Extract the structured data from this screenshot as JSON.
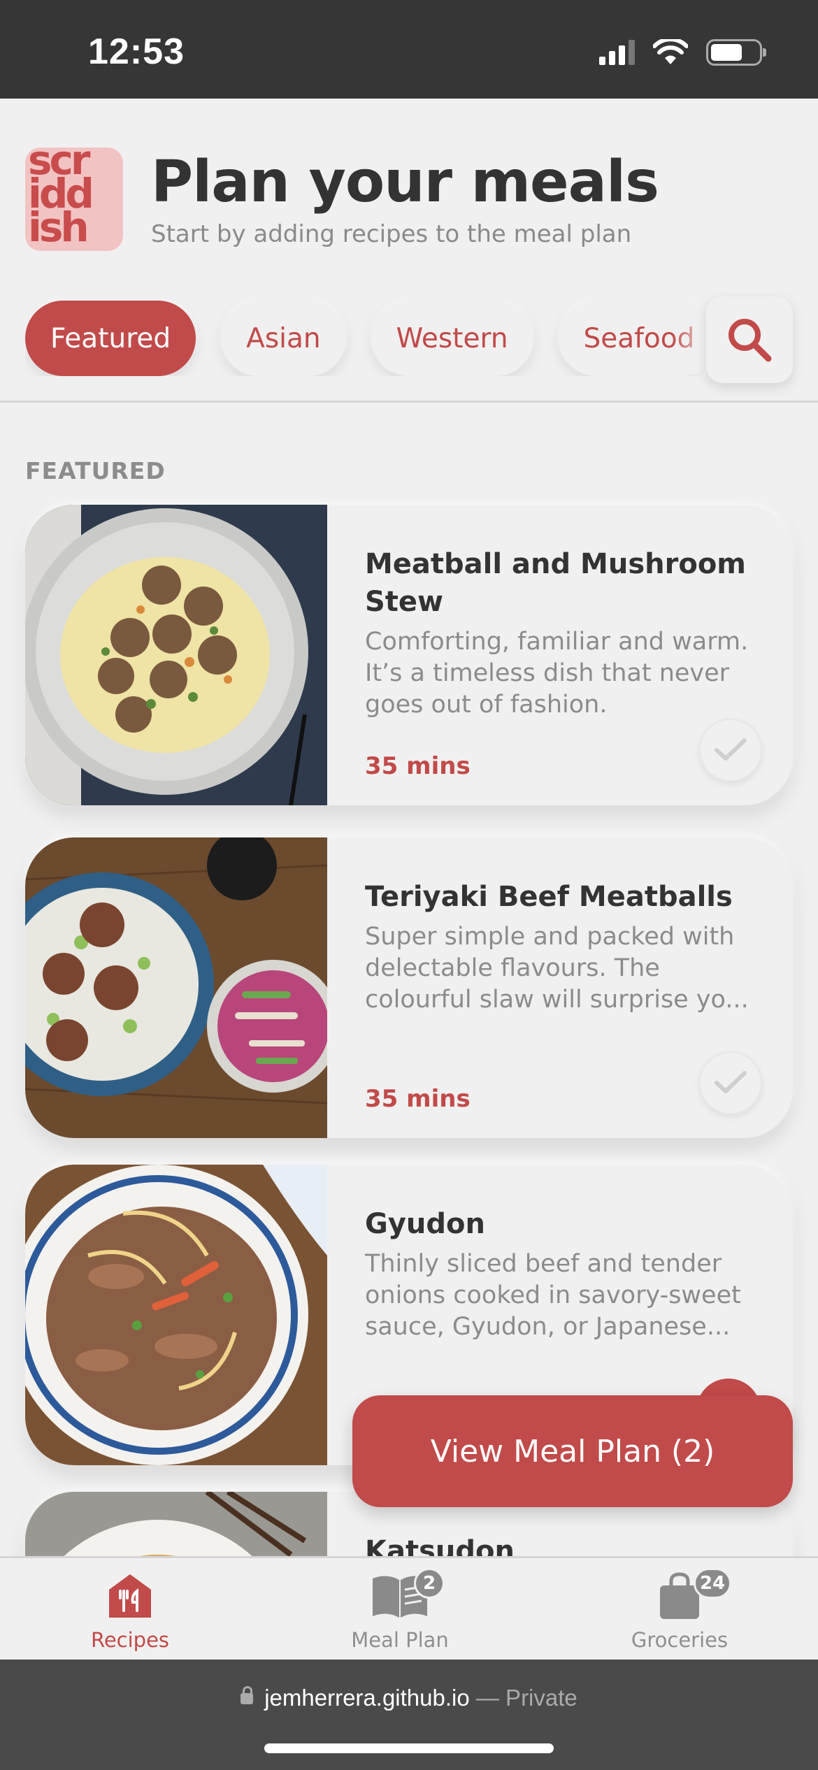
{
  "status_bar": {
    "time": "12:53"
  },
  "header": {
    "logo_text": [
      "scr",
      "idd",
      "ish"
    ],
    "title": "Plan your meals",
    "subtitle": "Start by adding recipes to the meal plan"
  },
  "categories": [
    "Featured",
    "Asian",
    "Western",
    "Seafood"
  ],
  "active_category": "Featured",
  "section_label": "FEATURED",
  "recipes": [
    {
      "title": "Meatball and Mushroom Stew",
      "description": "Comforting, familiar and warm. It’s a timeless dish that never goes out of fashion.",
      "time": "35 mins"
    },
    {
      "title": "Teriyaki Beef Meatballs",
      "description": "Super simple and packed with delectable flavours. The colourful slaw will surprise yo...",
      "time": "35 mins"
    },
    {
      "title": "Gyudon",
      "description": "Thinly sliced beef and tender onions cooked in savory-sweet sauce, Gyudon, or Japanese...",
      "time": ""
    },
    {
      "title": "Katsudon",
      "description": "",
      "time": ""
    }
  ],
  "fab": {
    "label": "View Meal Plan (2)"
  },
  "bottom_nav": [
    {
      "label": "Recipes",
      "badge": "",
      "icon": "recipes-icon"
    },
    {
      "label": "Meal Plan",
      "badge": "2",
      "icon": "book-icon"
    },
    {
      "label": "Groceries",
      "badge": "24",
      "icon": "bag-icon"
    }
  ],
  "browser": {
    "url": "jemherrera.github.io",
    "mode": "— Private"
  },
  "colors": {
    "accent": "#c14a4a",
    "background": "#f1f0f0",
    "status_bar": "#363636"
  }
}
